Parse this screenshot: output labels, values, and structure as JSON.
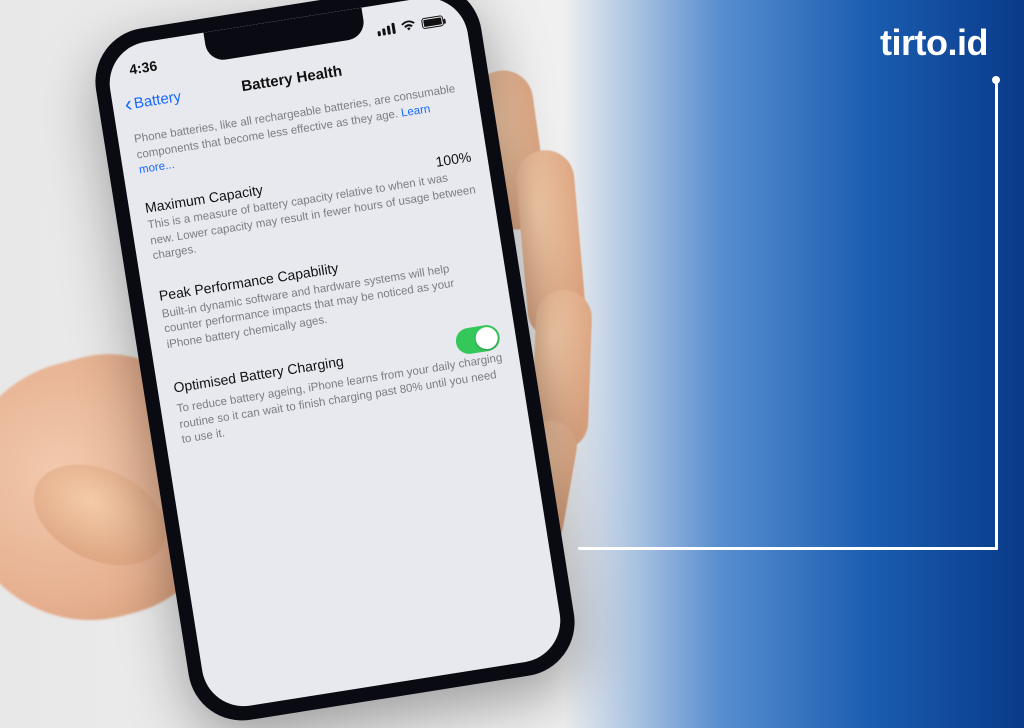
{
  "brand": {
    "logo_text": "tirto.id"
  },
  "phone": {
    "status": {
      "time": "4:36"
    },
    "nav": {
      "back_label": "Battery",
      "title": "Battery Health"
    },
    "intro": {
      "text": "Phone batteries, like all rechargeable batteries, are consumable components that become less effective as they age.",
      "learn_more": "Learn more..."
    },
    "max_capacity": {
      "label": "Maximum Capacity",
      "value": "100%",
      "desc": "This is a measure of battery capacity relative to when it was new. Lower capacity may result in fewer hours of usage between charges."
    },
    "peak": {
      "label": "Peak Performance Capability",
      "desc": "Built-in dynamic software and hardware systems will help counter performance impacts that may be noticed as your iPhone battery chemically ages."
    },
    "optimised": {
      "label": "Optimised Battery Charging",
      "enabled": true,
      "desc": "To reduce battery ageing, iPhone learns from your daily charging routine so it can wait to finish charging past 80% until you need to use it."
    }
  }
}
